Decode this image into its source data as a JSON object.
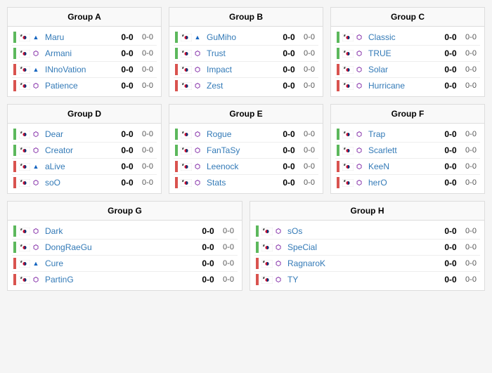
{
  "groups": [
    {
      "id": "group-a",
      "title": "Group A",
      "players": [
        {
          "name": "Maru",
          "race": "T",
          "nationality": "KR",
          "score_set": "0-0",
          "score_map": "0-0",
          "color": "green"
        },
        {
          "name": "Armani",
          "race": "Z",
          "nationality": "KR",
          "score_set": "0-0",
          "score_map": "0-0",
          "color": "green"
        },
        {
          "name": "INnoVation",
          "race": "T",
          "nationality": "KR",
          "score_set": "0-0",
          "score_map": "0-0",
          "color": "red"
        },
        {
          "name": "Patience",
          "race": "Z",
          "nationality": "KR",
          "score_set": "0-0",
          "score_map": "0-0",
          "color": "red"
        }
      ]
    },
    {
      "id": "group-b",
      "title": "Group B",
      "players": [
        {
          "name": "GuMiho",
          "race": "T",
          "nationality": "KR",
          "score_set": "0-0",
          "score_map": "0-0",
          "color": "green"
        },
        {
          "name": "Trust",
          "race": "Z",
          "nationality": "KR",
          "score_set": "0-0",
          "score_map": "0-0",
          "color": "green"
        },
        {
          "name": "Impact",
          "race": "Z",
          "nationality": "KR",
          "score_set": "0-0",
          "score_map": "0-0",
          "color": "red"
        },
        {
          "name": "Zest",
          "race": "Z",
          "nationality": "KR",
          "score_set": "0-0",
          "score_map": "0-0",
          "color": "red"
        }
      ]
    },
    {
      "id": "group-c",
      "title": "Group C",
      "players": [
        {
          "name": "Classic",
          "race": "Z",
          "nationality": "KR",
          "score_set": "0-0",
          "score_map": "0-0",
          "color": "green"
        },
        {
          "name": "TRUE",
          "race": "Z",
          "nationality": "KR",
          "score_set": "0-0",
          "score_map": "0-0",
          "color": "green"
        },
        {
          "name": "Solar",
          "race": "Z",
          "nationality": "KR",
          "score_set": "0-0",
          "score_map": "0-0",
          "color": "red"
        },
        {
          "name": "Hurricane",
          "race": "Z",
          "nationality": "KR",
          "score_set": "0-0",
          "score_map": "0-0",
          "color": "red"
        }
      ]
    },
    {
      "id": "group-d",
      "title": "Group D",
      "players": [
        {
          "name": "Dear",
          "race": "Z",
          "nationality": "KR",
          "score_set": "0-0",
          "score_map": "0-0",
          "color": "green"
        },
        {
          "name": "Creator",
          "race": "Z",
          "nationality": "KR",
          "score_set": "0-0",
          "score_map": "0-0",
          "color": "green"
        },
        {
          "name": "aLive",
          "race": "T",
          "nationality": "KR",
          "score_set": "0-0",
          "score_map": "0-0",
          "color": "red"
        },
        {
          "name": "soO",
          "race": "Z",
          "nationality": "KR",
          "score_set": "0-0",
          "score_map": "0-0",
          "color": "red"
        }
      ]
    },
    {
      "id": "group-e",
      "title": "Group E",
      "players": [
        {
          "name": "Rogue",
          "race": "Z",
          "nationality": "KR",
          "score_set": "0-0",
          "score_map": "0-0",
          "color": "green"
        },
        {
          "name": "FanTaSy",
          "race": "Z",
          "nationality": "KR",
          "score_set": "0-0",
          "score_map": "0-0",
          "color": "green"
        },
        {
          "name": "Leenock",
          "race": "Z",
          "nationality": "KR",
          "score_set": "0-0",
          "score_map": "0-0",
          "color": "red"
        },
        {
          "name": "Stats",
          "race": "Z",
          "nationality": "KR",
          "score_set": "0-0",
          "score_map": "0-0",
          "color": "red"
        }
      ]
    },
    {
      "id": "group-f",
      "title": "Group F",
      "players": [
        {
          "name": "Trap",
          "race": "Z",
          "nationality": "KR",
          "score_set": "0-0",
          "score_map": "0-0",
          "color": "green"
        },
        {
          "name": "Scarlett",
          "race": "Z",
          "nationality": "KR",
          "score_set": "0-0",
          "score_map": "0-0",
          "color": "green"
        },
        {
          "name": "KeeN",
          "race": "Z",
          "nationality": "KR",
          "score_set": "0-0",
          "score_map": "0-0",
          "color": "red"
        },
        {
          "name": "herO",
          "race": "Z",
          "nationality": "KR",
          "score_set": "0-0",
          "score_map": "0-0",
          "color": "red"
        }
      ]
    },
    {
      "id": "group-g",
      "title": "Group G",
      "players": [
        {
          "name": "Dark",
          "race": "Z",
          "nationality": "KR",
          "score_set": "0-0",
          "score_map": "0-0",
          "color": "green"
        },
        {
          "name": "DongRaeGu",
          "race": "Z",
          "nationality": "KR",
          "score_set": "0-0",
          "score_map": "0-0",
          "color": "green"
        },
        {
          "name": "Cure",
          "race": "T",
          "nationality": "KR",
          "score_set": "0-0",
          "score_map": "0-0",
          "color": "red"
        },
        {
          "name": "PartinG",
          "race": "Z",
          "nationality": "KR",
          "score_set": "0-0",
          "score_map": "0-0",
          "color": "red"
        }
      ]
    },
    {
      "id": "group-h",
      "title": "Group H",
      "players": [
        {
          "name": "sOs",
          "race": "Z",
          "nationality": "KR",
          "score_set": "0-0",
          "score_map": "0-0",
          "color": "green"
        },
        {
          "name": "SpeCial",
          "race": "Z",
          "nationality": "KR",
          "score_set": "0-0",
          "score_map": "0-0",
          "color": "green"
        },
        {
          "name": "RagnaroK",
          "race": "Z",
          "nationality": "KR",
          "score_set": "0-0",
          "score_map": "0-0",
          "color": "red"
        },
        {
          "name": "TY",
          "race": "Z",
          "nationality": "KR",
          "score_set": "0-0",
          "score_map": "0-0",
          "color": "red"
        }
      ]
    }
  ],
  "race_icons": {
    "T": "▲",
    "Z": "⬟",
    "P": "◆"
  }
}
